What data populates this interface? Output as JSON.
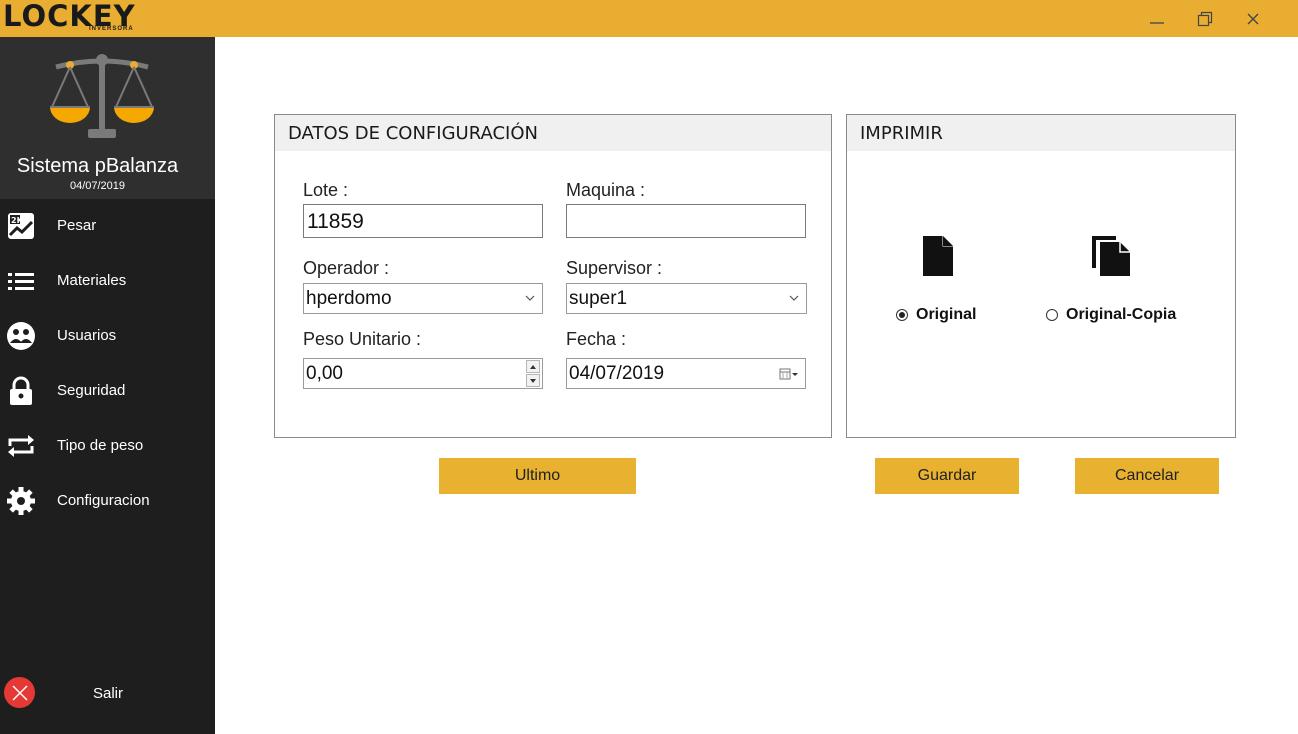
{
  "window": {
    "logo_text": "LOCKEY",
    "logo_subtext": "INVERSORA",
    "minimize_icon": "minimize-icon",
    "maximize_icon": "restore-icon",
    "close_icon": "close-icon",
    "accent_color": "#E8AD31"
  },
  "sidebar": {
    "app_title": "Sistema pBalanza",
    "app_date": "04/07/2019",
    "items": [
      {
        "label": "Pesar",
        "icon": "weigh-chart-icon"
      },
      {
        "label": "Materiales",
        "icon": "list-icon"
      },
      {
        "label": "Usuarios",
        "icon": "users-icon"
      },
      {
        "label": "Seguridad",
        "icon": "lock-icon"
      },
      {
        "label": "Tipo de peso",
        "icon": "repeat-icon"
      },
      {
        "label": "Configuracion",
        "icon": "gear-icon"
      }
    ],
    "exit_label": "Salir"
  },
  "config_panel": {
    "title": "DATOS DE CONFIGURACIÓN",
    "lote_label": "Lote :",
    "lote_value": "11859",
    "maquina_label": "Maquina  :",
    "maquina_value": "",
    "operador_label": "Operador :",
    "operador_value": "hperdomo",
    "supervisor_label": "Supervisor :",
    "supervisor_value": "super1",
    "peso_label": "Peso Unitario :",
    "peso_value": "0,00",
    "fecha_label": "Fecha  :",
    "fecha_value": "04/07/2019"
  },
  "print_panel": {
    "title": "IMPRIMIR",
    "option_original": "Original",
    "option_copia": "Original-Copia",
    "selected": "Original"
  },
  "buttons": {
    "ultimo": "Ultimo",
    "guardar": "Guardar",
    "cancelar": "Cancelar"
  }
}
